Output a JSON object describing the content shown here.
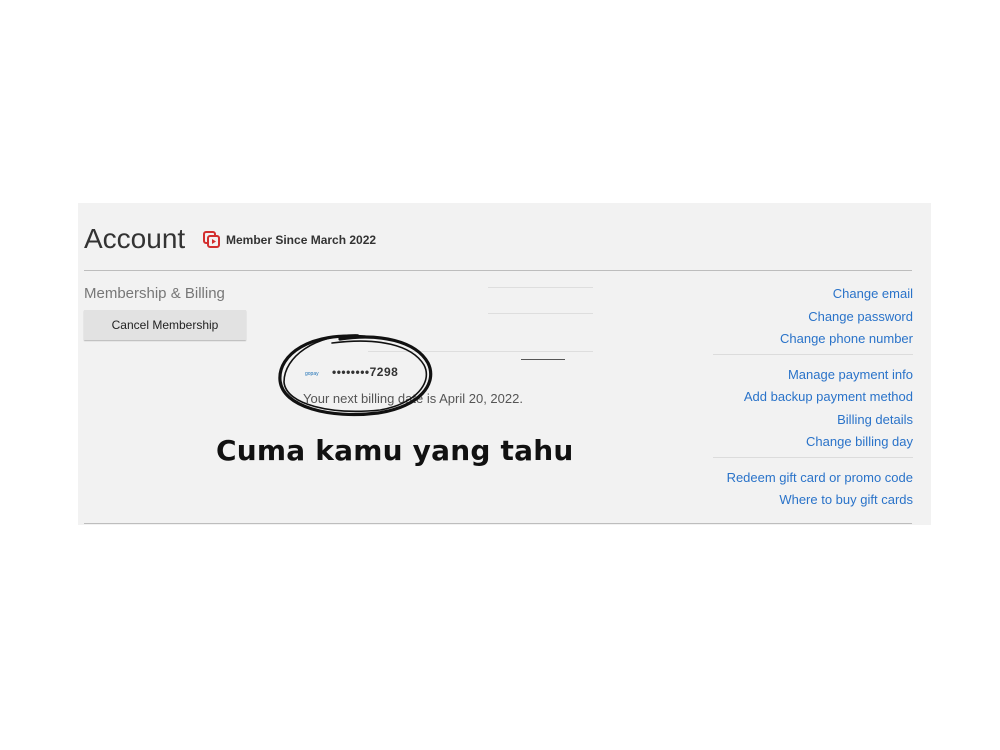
{
  "account": {
    "title": "Account",
    "member_since": "Member Since March 2022",
    "section_label": "Membership & Billing",
    "cancel_button": "Cancel Membership"
  },
  "payment": {
    "card_brand": "gopay",
    "card_number": "••••••••7298",
    "next_billing": "Your next billing date is April 20, 2022."
  },
  "links": {
    "group1": [
      "Change email",
      "Change password",
      "Change phone number"
    ],
    "group2": [
      "Manage payment info",
      "Add backup payment method",
      "Billing details",
      "Change billing day"
    ],
    "group3": [
      "Redeem gift card or promo code",
      "Where to buy gift cards"
    ]
  },
  "caption": "Cuma kamu yang tahu",
  "colors": {
    "link": "#2a73c9",
    "panel": "#f2f2f2",
    "brand_icon": "#d32f2f"
  }
}
